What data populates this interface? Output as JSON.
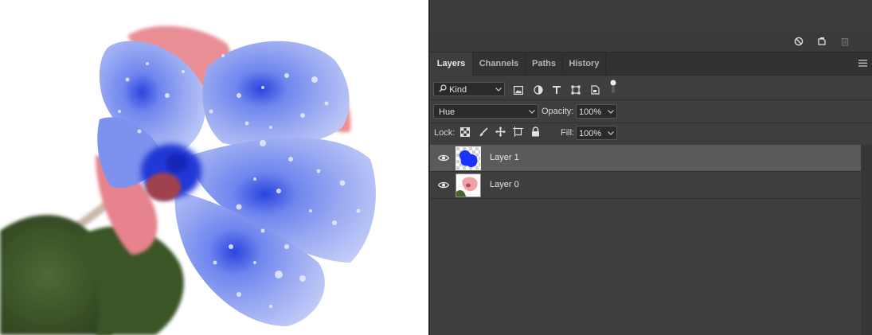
{
  "canvas": {
    "image_name": "blue-flower-photo"
  },
  "actions": {
    "icons": [
      "no-entry-icon",
      "new-layer-icon",
      "trash-icon"
    ]
  },
  "tabs": [
    {
      "label": "Layers",
      "active": true
    },
    {
      "label": "Channels",
      "active": false
    },
    {
      "label": "Paths",
      "active": false
    },
    {
      "label": "History",
      "active": false
    }
  ],
  "filter": {
    "kind": "Kind",
    "icons": [
      "image-filter-icon",
      "adjustment-filter-icon",
      "type-filter-icon",
      "shape-filter-icon",
      "smart-object-filter-icon",
      "filter-toggle-icon"
    ]
  },
  "blend": {
    "mode": "Hue",
    "opacity_label": "Opacity:",
    "opacity_value": "100%"
  },
  "lock": {
    "label": "Lock:",
    "icons": [
      "lock-transparent-pixels-icon",
      "lock-image-pixels-icon",
      "lock-position-icon",
      "lock-artboard-icon",
      "lock-all-icon"
    ],
    "fill_label": "Fill:",
    "fill_value": "100%"
  },
  "layers": [
    {
      "name": "Layer 1",
      "selected": true,
      "visible": true
    },
    {
      "name": "Layer 0",
      "selected": false,
      "visible": true
    }
  ],
  "colors": {
    "panel_bg": "#3e3e3e",
    "selected_layer": "#5a5a5a",
    "flower_blue": "#8fa2f0",
    "petal_pink": "#e98b93",
    "leaf_green": "#3f5a2c",
    "layer_thumb_blue": "#1a32ff"
  }
}
